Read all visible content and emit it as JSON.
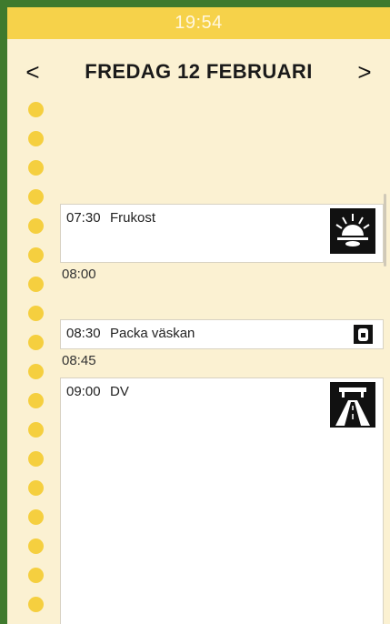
{
  "status": {
    "time": "19:54"
  },
  "header": {
    "prev": "<",
    "title": "FREDAG 12 FEBRUARI",
    "next": ">"
  },
  "events": [
    {
      "time": "07:30",
      "title": "Frukost",
      "icon": "sunrise-icon"
    },
    {
      "time": "08:30",
      "title": "Packa väskan",
      "icon": "backpack-icon"
    },
    {
      "time": "09:00",
      "title": "DV",
      "icon": "road-icon"
    }
  ],
  "markers": [
    "08:00",
    "08:45"
  ],
  "colors": {
    "frame": "#3f7a2d",
    "statusbar": "#f6d24a",
    "background": "#fbf1d2",
    "dot": "#f5cf3f"
  }
}
